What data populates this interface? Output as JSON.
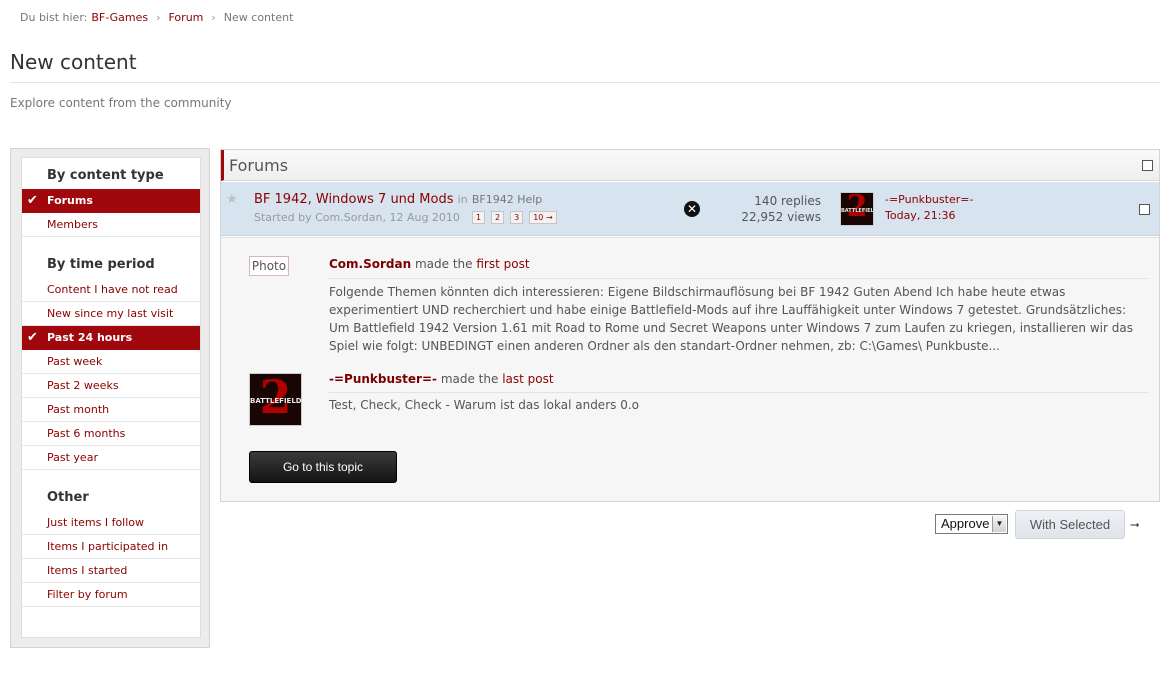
{
  "breadcrumb": {
    "prefix": "Du bist hier:",
    "items": [
      "BF-Games",
      "Forum",
      "New content"
    ],
    "separator": "›"
  },
  "page": {
    "title": "New content",
    "description": "Explore content from the community"
  },
  "sidebar": {
    "sections": [
      {
        "heading": "By content type",
        "items": [
          {
            "label": "Forums",
            "active": true
          },
          {
            "label": "Members",
            "active": false
          }
        ]
      },
      {
        "heading": "By time period",
        "items": [
          {
            "label": "Content I have not read",
            "active": false
          },
          {
            "label": "New since my last visit",
            "active": false
          },
          {
            "label": "Past 24 hours",
            "active": true
          },
          {
            "label": "Past week",
            "active": false
          },
          {
            "label": "Past 2 weeks",
            "active": false
          },
          {
            "label": "Past month",
            "active": false
          },
          {
            "label": "Past 6 months",
            "active": false
          },
          {
            "label": "Past year",
            "active": false
          }
        ]
      },
      {
        "heading": "Other",
        "items": [
          {
            "label": "Just items I follow",
            "active": false
          },
          {
            "label": "Items I participated in",
            "active": false
          },
          {
            "label": "Items I started",
            "active": false
          },
          {
            "label": "Filter by forum",
            "active": false
          }
        ]
      }
    ]
  },
  "forums": {
    "header": "Forums",
    "topic": {
      "title": "BF 1942, Windows 7 und Mods",
      "in_text": "in",
      "forum_name": "BF1942 Help",
      "started_by": "Started by Com.Sordan, 12 Aug 2010",
      "pages": [
        "1",
        "2",
        "3",
        "10 →"
      ],
      "replies": "140 replies",
      "views": "22,952 views",
      "last_poster": "-=Punkbuster=-",
      "last_time": "Today, 21:36",
      "avatar_text": {
        "num": "2",
        "brand": "BATTLEFIELD"
      }
    },
    "preview": {
      "photo_label": "Photo",
      "first_post": {
        "author": "Com.Sordan",
        "made_the": "made the",
        "link": "first post",
        "body": "Folgende Themen könnten dich interessieren: Eigene Bildschirmauflösung bei BF 1942 Guten Abend Ich habe heute etwas experimentiert UND recherchiert und habe einige Battlefield-Mods auf ihre Lauffähigkeit unter Windows 7 getestet. Grundsätzliches: Um Battlefield 1942 Version 1.61 mit Road to Rome und Secret Weapons unter Windows 7 zum Laufen zu kriegen, installieren wir das Spiel wie folgt: UNBEDINGT einen anderen Ordner als den standart-Ordner nehmen, zb: C:\\Games\\ Punkbuste..."
      },
      "last_post": {
        "author": "-=Punkbuster=-",
        "made_the": "made the",
        "link": "last post",
        "body": "Test, Check, Check - Warum ist das lokal anders 0.o"
      },
      "go_button": "Go to this topic"
    }
  },
  "moderation": {
    "select_value": "Approve",
    "with_selected": "With Selected",
    "arrow": "▼",
    "go_icon": "⭢"
  },
  "colors": {
    "accent": "#a0080e",
    "link": "#8b0000",
    "row_highlight": "#d7e3ee"
  }
}
